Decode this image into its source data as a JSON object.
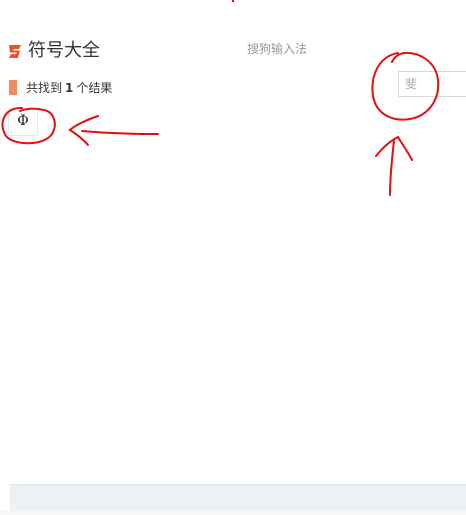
{
  "header": {
    "logo_icon": "sogou-s-icon",
    "app_title": "符号大全",
    "subtitle": "搜狗输入法"
  },
  "search": {
    "value": "斐"
  },
  "results": {
    "prefix": "共找到",
    "count": "1",
    "suffix": "个结果",
    "symbols": [
      "Φ"
    ]
  },
  "colors": {
    "accent": "#f08a60",
    "annotation": "#e01010",
    "footer": "#eef1f3"
  }
}
